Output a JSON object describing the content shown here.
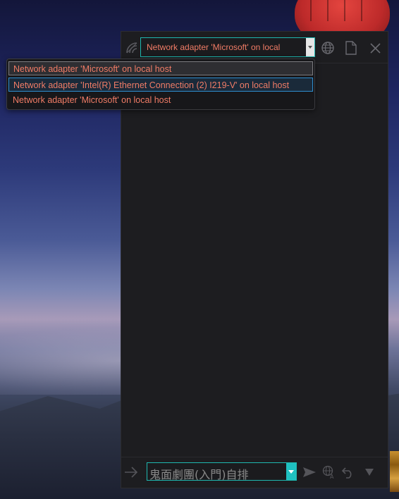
{
  "adapter_select": {
    "value": "Network adapter 'Microsoft' on local"
  },
  "adapter_options": [
    "Network adapter 'Microsoft' on local host",
    "Network adapter 'Intel(R) Ethernet Connection (2) I219-V' on local host",
    "Network adapter 'Microsoft' on local host"
  ],
  "footer": {
    "filter_value": "鬼面劇團(入門)自排"
  },
  "icons": {
    "header": [
      "wifi-signal-icon",
      "globe-icon",
      "new-file-icon",
      "close-icon"
    ],
    "footer": [
      "arrow-right-icon",
      "send-icon",
      "translate-icon",
      "undo-icon",
      "triangle-down-icon"
    ]
  },
  "colors": {
    "accent": "#1fb7b0",
    "option_text": "#f07c66",
    "panel_bg": "#1d1d20"
  }
}
